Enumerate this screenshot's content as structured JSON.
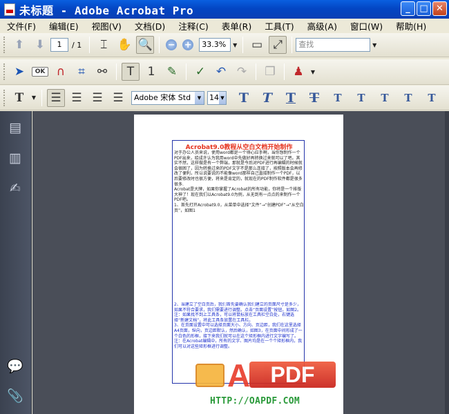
{
  "window": {
    "title": "未标题 - Adobe Acrobat Pro",
    "minimize": "_",
    "maximize": "□",
    "close": "✕"
  },
  "menu": [
    "文件(F)",
    "编辑(E)",
    "视图(V)",
    "文档(D)",
    "注释(C)",
    "表单(R)",
    "工具(T)",
    "高级(A)",
    "窗口(W)",
    "帮助(H)"
  ],
  "toolbar1": {
    "page_current": "1",
    "page_total": "/ 1",
    "zoom": "33.3%",
    "search_placeholder": "查找",
    "zoom_out": "−",
    "zoom_in": "+"
  },
  "toolbar2": {
    "ok_label": "OK"
  },
  "toolbar3": {
    "font_name": "Adobe 宋体 Std",
    "font_size": "14",
    "text_style_glyphs": [
      "T",
      "T",
      "T",
      "T",
      "T",
      "T",
      "T",
      "T",
      "T"
    ]
  },
  "document": {
    "title": "Acrobat9.0教程从空白文档开始制作",
    "body_black": [
      "对于办公人员来说，使用word都是一个得心应手啊，当你想制作一个PDF出来，给成许认为我用word中先做好再转换过来就可以了吧。其实不然，这样做是有一个弊端，那就是今后对PDF进行再编辑的时候就会很困了，因为转换过来的PDF文字不是那么连接了，按照版本会再修改了便利，所以说要说的不能像word那样自己直接制作一个PDF，以后要修改时也很方便，将来是肯定的，就现在的PDF制作软件都是很多很多.",
      "Acrobat是大牌，如果你掌握了Acrobat的所有功能，你将是一个排版大神了！现在我们以Acrobat9.0为例，从无到有一点点的来制作一个PDF吧。",
      "1、首先打开Acrobat9.0，从菜单中选择“文件”→“创建PDF”→“从空白页”，如图1"
    ],
    "body_blue": [
      "2、当建立了空白页后，我们首先要确认我们建立的页面尺寸是多少，如果不符合要求，我们需要进行调整。点击“页面设置”按钮，如图2。",
      "注：如果找不到上工具条，可以将鼠标放在工具栏空白处，右键选择“新建文档”，将此工具条放置在工具栏。",
      "3、在页面设置中可以选择页面大小、方向、页边距，我们在这里选择A4页面，纵向，页边距默认，然后确认，如图3，在页面中间形成了一个白色的形框，接下来我们就可以在这个矩形框内进行文字编写了。",
      "注：在Acrobat编辑中，所有的文字、图片均是在一个个矩形框内，我们可以对这些矩形框进行调整。"
    ]
  },
  "watermark": {
    "letter": "A",
    "brand": "PDF",
    "url": "HTTP://OAPDF.COM"
  }
}
